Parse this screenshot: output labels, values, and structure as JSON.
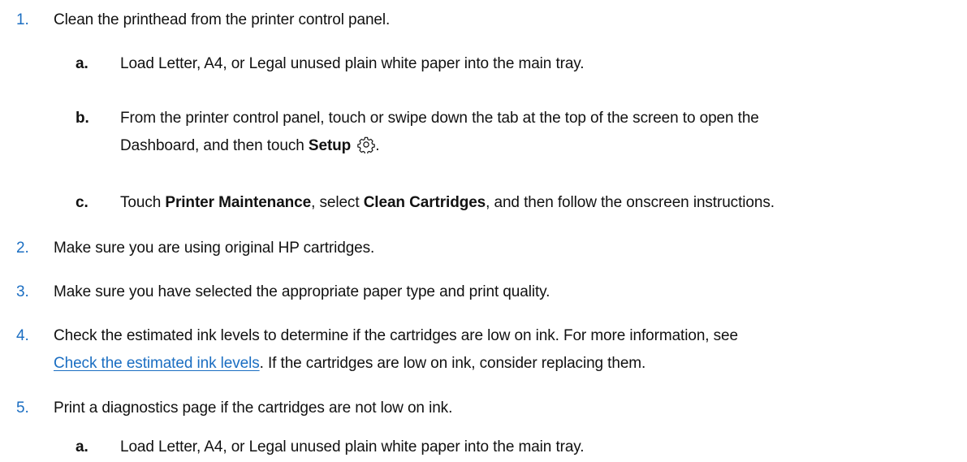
{
  "steps": {
    "s1": {
      "num": "1.",
      "text": "Clean the printhead from the printer control panel."
    },
    "s1a": {
      "letter": "a.",
      "text": "Load Letter, A4, or Legal unused plain white paper into the main tray."
    },
    "s1b": {
      "letter": "b.",
      "line1": "From the printer control panel, touch or swipe down the tab at the top of the screen to open the",
      "line2_pre": "Dashboard, and then touch ",
      "line2_bold": "Setup",
      "line2_post": ".",
      "icon": "gear-icon"
    },
    "s1c": {
      "letter": "c.",
      "pre": "Touch ",
      "bold1": "Printer Maintenance",
      "mid": ", select ",
      "bold2": "Clean Cartridges",
      "post": ", and then follow the onscreen instructions."
    },
    "s2": {
      "num": "2.",
      "text": "Make sure you are using original HP cartridges."
    },
    "s3": {
      "num": "3.",
      "text": "Make sure you have selected the appropriate paper type and print quality."
    },
    "s4": {
      "num": "4.",
      "line1": "Check the estimated ink levels to determine if the cartridges are low on ink. For more information, see",
      "link": "Check the estimated ink levels",
      "line2_post": ". If the cartridges are low on ink, consider replacing them."
    },
    "s5": {
      "num": "5.",
      "text": "Print a diagnostics page if the cartridges are not low on ink."
    },
    "s5a": {
      "letter": "a.",
      "text": "Load Letter, A4, or Legal unused plain white paper into the main tray."
    }
  },
  "colors": {
    "step_number": "#1b6ec2",
    "link": "#1b6ec2",
    "text": "#111111"
  }
}
